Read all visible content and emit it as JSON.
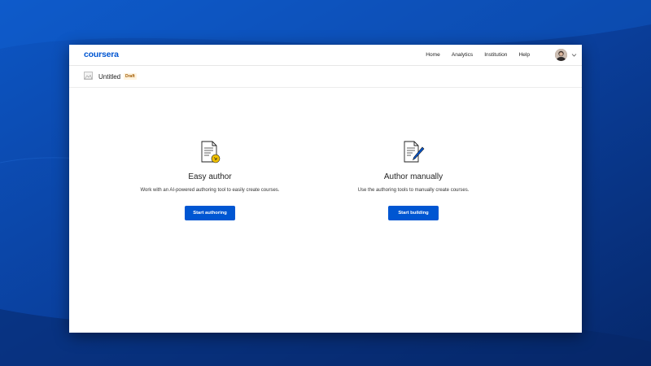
{
  "header": {
    "logo_text": "coursera",
    "nav": [
      {
        "label": "Home"
      },
      {
        "label": "Analytics"
      },
      {
        "label": "Institution"
      },
      {
        "label": "Help"
      }
    ]
  },
  "course": {
    "title": "Untitled",
    "status_badge": "Draft"
  },
  "options": [
    {
      "title": "Easy author",
      "description": "Work with an AI-powered authoring tool to easily create courses.",
      "button_label": "Start authoring"
    },
    {
      "title": "Author manually",
      "description": "Use the authoring tools to manually create courses.",
      "button_label": "Start building"
    }
  ],
  "colors": {
    "brand": "#0056d2",
    "background": "#0a3f9c",
    "badge_text": "#a05a00",
    "badge_bg": "#fff4e0"
  }
}
